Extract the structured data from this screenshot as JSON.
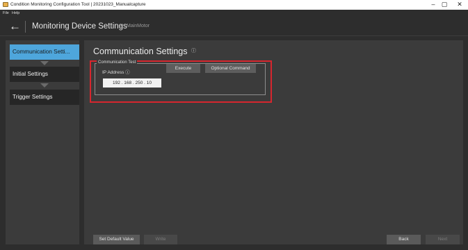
{
  "window": {
    "title": "Condition Monitoring Configuration Tool | 20231023_Manualcapture",
    "minimize": "–",
    "maximize": "▢",
    "close": "✕"
  },
  "menu": {
    "file": "File",
    "help": "Help"
  },
  "header": {
    "back": "←",
    "title": "Monitoring Device Settings",
    "crumb_separator": ">",
    "breadcrumb": "MainMotor"
  },
  "sidebar": {
    "items": [
      {
        "label": "Communication Setti..."
      },
      {
        "label": "Initial Settings"
      },
      {
        "label": "Trigger Settings"
      }
    ]
  },
  "main": {
    "title": "Communication Settings",
    "info": "ⓘ",
    "group_label": "Communication Test",
    "ip_label": "IP Address",
    "ip_info": "ⓘ",
    "ip_value": "192 . 168 . 250 . 10",
    "execute": "Execute",
    "optional_command": "Optional Command"
  },
  "footer": {
    "set_default": "Set Default Value",
    "write": "Write",
    "back": "Back",
    "next": "Next"
  },
  "colors": {
    "accent": "#4ea6dc",
    "highlight": "#d7262e",
    "panel": "#3b3b3b",
    "background": "#2d2d2d"
  },
  "icons": [
    "app-icon",
    "back-arrow-icon",
    "info-icon",
    "minimize-icon",
    "maximize-icon",
    "close-icon"
  ]
}
